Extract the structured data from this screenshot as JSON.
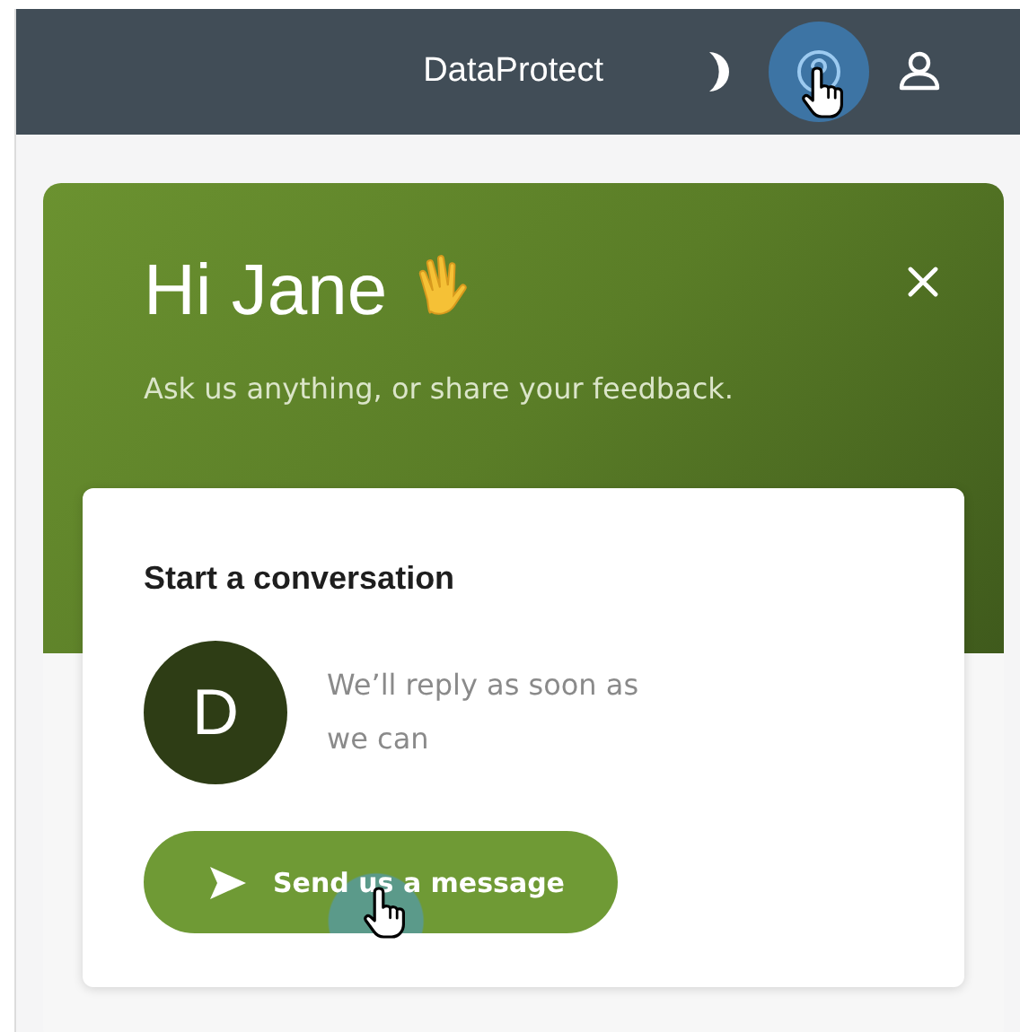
{
  "top_bar": {
    "brand": "DataProtect",
    "icons": [
      {
        "kind": "moon",
        "highlighted": false
      },
      {
        "kind": "help",
        "highlighted": true
      },
      {
        "kind": "user",
        "highlighted": false
      }
    ]
  },
  "help_panel": {
    "greeting": "Hi Jane",
    "subtitle": "Ask us anything, or share your feedback.",
    "conversation": {
      "title": "Start a conversation",
      "avatar_letter": "D",
      "reply_note": "We’ll reply as soon as we can",
      "button": {
        "label": "Send us a message",
        "highlighted": true
      }
    }
  }
}
